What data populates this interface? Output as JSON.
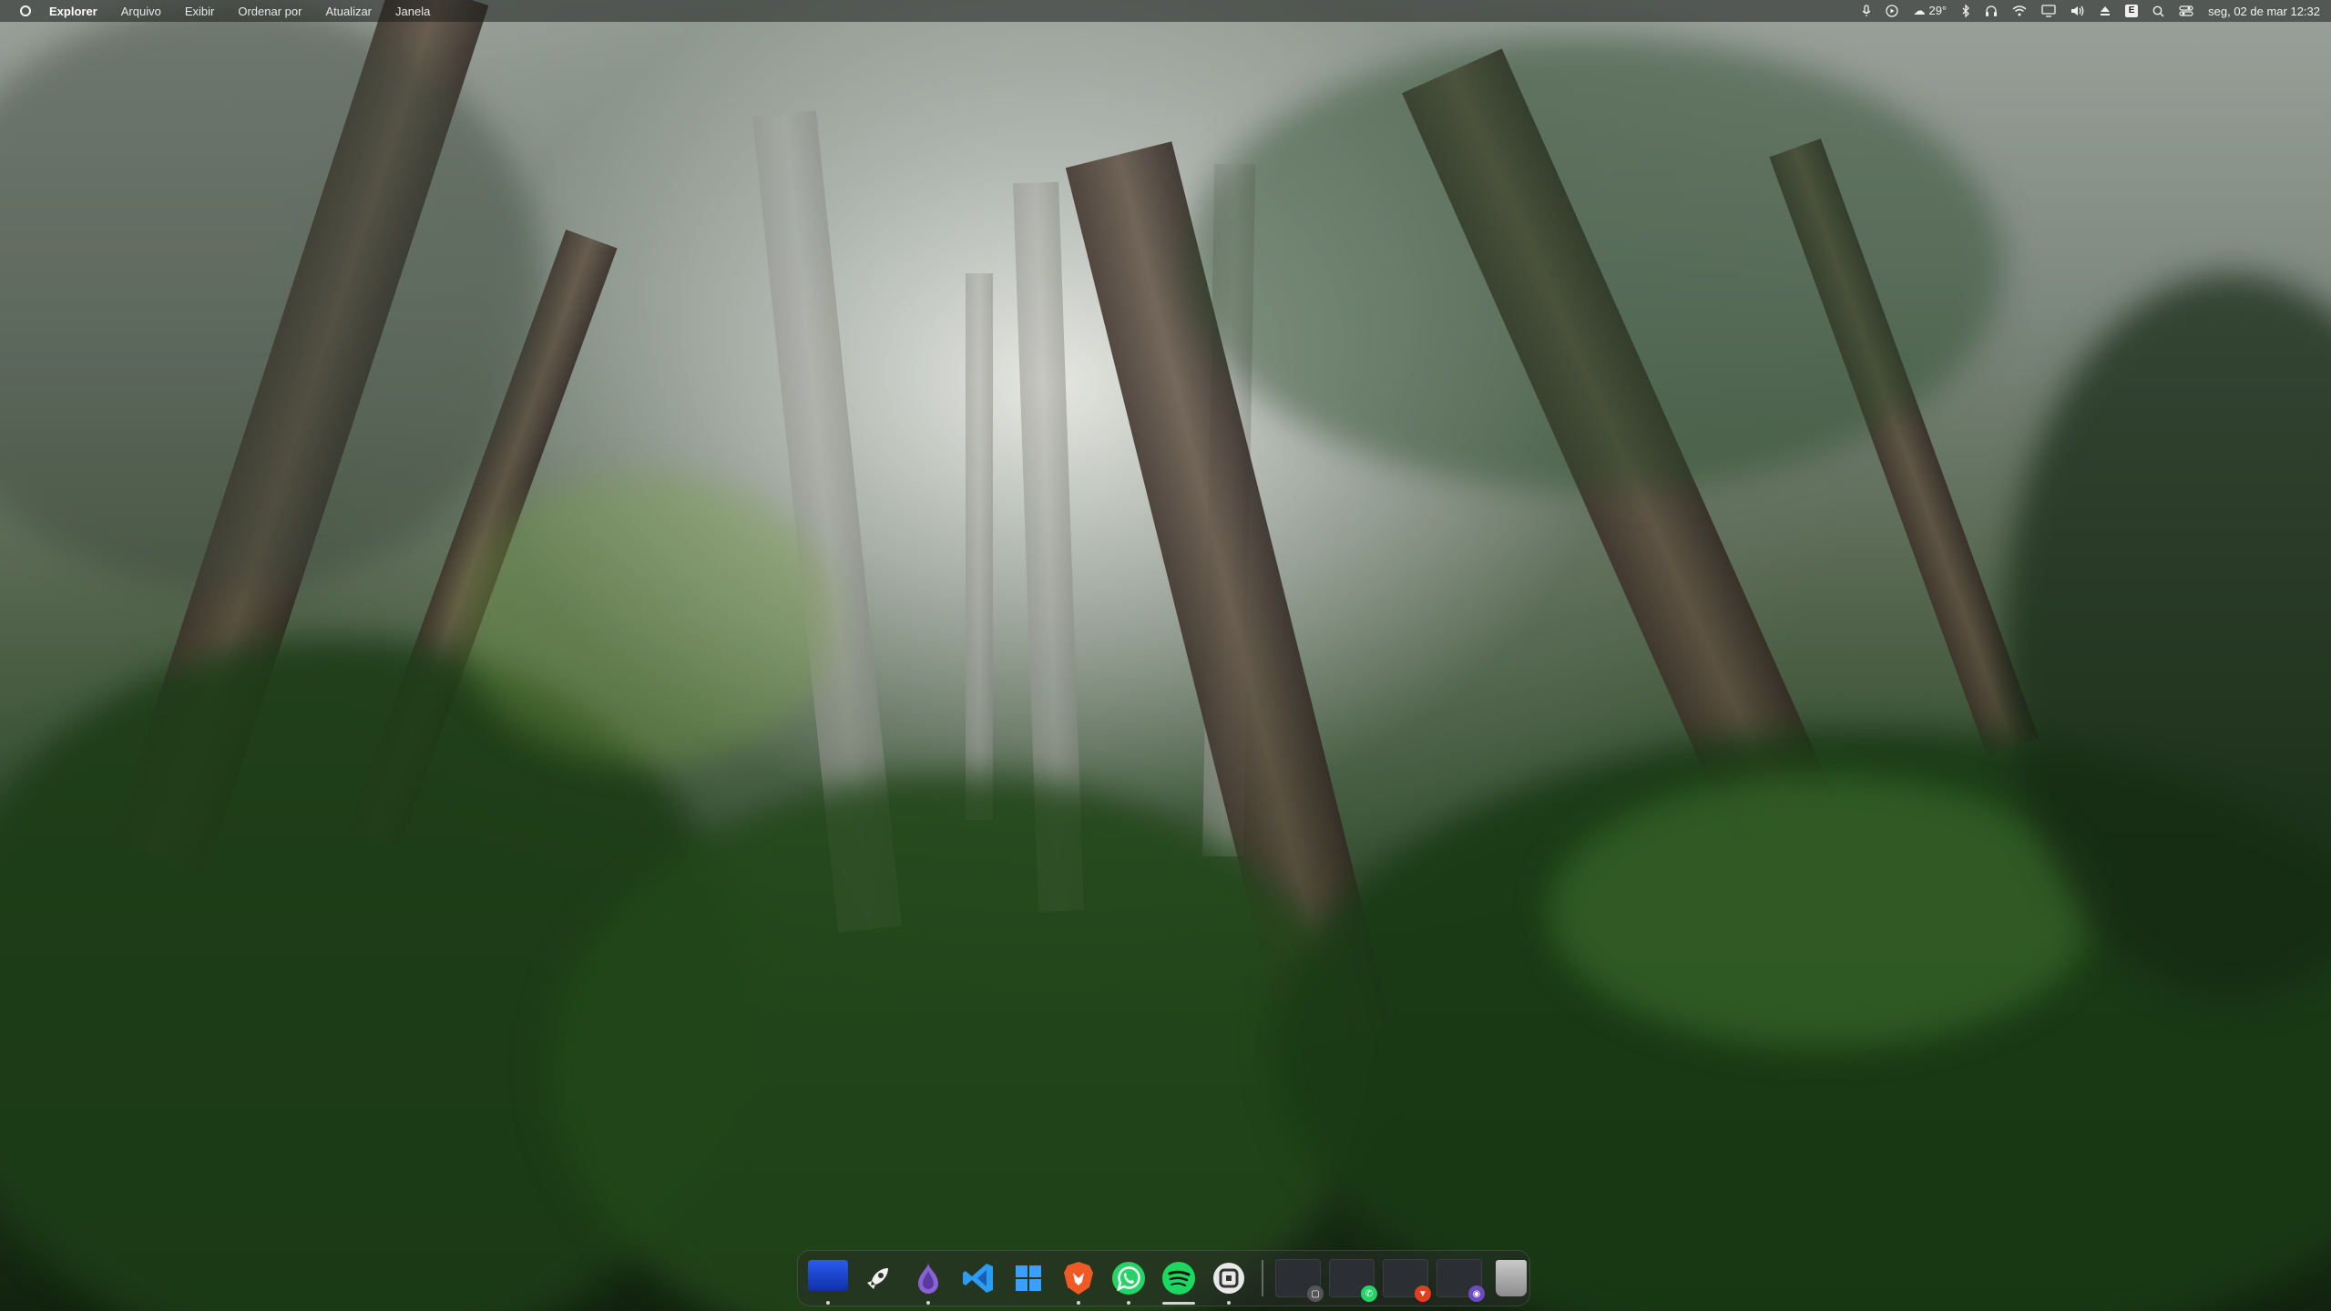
{
  "menubar": {
    "app_name": "Explorer",
    "menu_items": [
      "Arquivo",
      "Exibir",
      "Ordenar por",
      "Atualizar",
      "Janela"
    ],
    "tray": {
      "mic_icon": "microphone-icon",
      "media_icon": "play-circle-icon",
      "weather_icon": "cloud-sun-icon",
      "weather_temp": "29°",
      "bluetooth_icon": "bluetooth-icon",
      "headphones_icon": "headphones-icon",
      "wifi_icon": "wifi-icon",
      "display_icon": "display-icon",
      "volume_icon": "speaker-icon",
      "eject_icon": "eject-icon",
      "keyboard_badge": "E",
      "search_icon": "search-icon",
      "control_center_icon": "control-center-icon"
    },
    "clock": "seg, 02 de mar 12:32"
  },
  "dock": {
    "apps": [
      {
        "name": "desktop-monitor",
        "color": "#1f48d6",
        "glyph": "▭",
        "running": true
      },
      {
        "name": "launchpad-rocket",
        "color": "transparent",
        "glyph": "🚀",
        "running": false
      },
      {
        "name": "tor-browser",
        "color": "#6c4bbf",
        "glyph": "◉",
        "running": true
      },
      {
        "name": "vscode",
        "color": "transparent",
        "glyph": "❮❯",
        "running": false
      },
      {
        "name": "windows",
        "color": "transparent",
        "glyph": "⊞",
        "running": false
      },
      {
        "name": "brave-browser",
        "color": "#e0401f",
        "glyph": "▼",
        "running": true
      },
      {
        "name": "whatsapp",
        "color": "#25d366",
        "glyph": "✆",
        "running": true
      },
      {
        "name": "spotify",
        "color": "#1ed760",
        "glyph": "≋",
        "running": true
      },
      {
        "name": "terminal-app",
        "color": "#e6e6e6",
        "glyph": "▢",
        "running": true
      }
    ],
    "minimized_windows": [
      {
        "name": "window-thumb-1",
        "badge_color": "#555",
        "badge_glyph": "▢"
      },
      {
        "name": "window-thumb-2",
        "badge_color": "#25d366",
        "badge_glyph": "✆"
      },
      {
        "name": "window-thumb-3",
        "badge_color": "#e0401f",
        "badge_glyph": "▼"
      },
      {
        "name": "window-thumb-4",
        "badge_color": "#6c4bbf",
        "badge_glyph": "◉"
      }
    ],
    "trash_icon": "trash-icon"
  }
}
